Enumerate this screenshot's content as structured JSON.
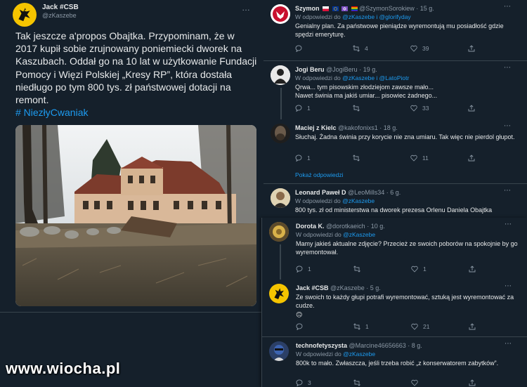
{
  "main_tweet": {
    "author_name": "Jack #CSB",
    "author_handle": "@zKaszebe",
    "text": "Tak jeszcze a'propos Obajtka. Przypominam, że w 2017 kupił sobie zrujnowany poniemiecki dworek na Kaszubach. Oddał go na 10 lat w użytkowanie Fundacji Pomocy i Więzi Polskiej „Kresy RP”, która dostała niedługo po tym 800 tys. zł państwowej dotacji na remont.",
    "hashtag": "# NiezłyCwaniak",
    "more_icon": "…"
  },
  "watermark": "www.wiocha.pl",
  "replies": [
    {
      "name": "Szymon",
      "handle": "@SzymonSorokiew",
      "time": "· 15 g.",
      "reply_prefix": "W odpowiedzi do",
      "reply_to": "@zKaszebe i @glorifyday",
      "text": "Genialny plan. Za państwowe pieniądze wyremontują mu posiadłość gdzie spędzi  emeryturę.",
      "comments": "",
      "retweets": "4",
      "likes": "39"
    },
    {
      "name": "Jogi Beru",
      "handle": "@JogiBeru",
      "time": "· 19 g.",
      "reply_prefix": "W odpowiedzi do",
      "reply_to": "@zKaszebe i @LatoPiotr",
      "text": "Qrwa... tym pisowskim złodziejom zawsze mało...\nNawet świnia ma jakiś umiar... pisowiec żadnego...",
      "comments": "1",
      "retweets": "",
      "likes": "33"
    },
    {
      "name": "Maciej z Kielc",
      "handle": "@kakofonixs1",
      "time": "· 18 g.",
      "text": "Słuchaj. Żadna świnia przy korycie nie zna umiaru. Tak więc nie pierdol głupot.",
      "comments": "1",
      "retweets": "",
      "likes": "11",
      "show_more": "Pokaż odpowiedzi"
    },
    {
      "name": "Leonard Paweł D",
      "handle": "@LeoMills34",
      "time": "· 6 g.",
      "reply_prefix": "W odpowiedzi do",
      "reply_to": "@zKaszebe",
      "text": "800 tys. zł od ministerstwa na dworek prezesa Orlenu Daniela Obajtka"
    },
    {
      "name": "Dorota K.",
      "handle": "@dorotkaeich",
      "time": "· 10 g.",
      "reply_prefix": "W odpowiedzi do",
      "reply_to": "@zKaszebe",
      "text": "Mamy jakieś aktualne zdjęcie? Przecież ze swoich poborów na spokojnie by go wyremontował.",
      "comments": "1",
      "retweets": "",
      "likes": "1"
    },
    {
      "name": "Jack #CSB",
      "handle": "@zKaszebe",
      "time": "· 5 g.",
      "text": "Ze swoich to każdy głupi potrafi wyremontować, sztuką jest wyremontować za cudze.",
      "emoji": "🙃",
      "comments": "",
      "retweets": "1",
      "likes": "21"
    },
    {
      "name": "technofetyszysta",
      "handle": "@Marcine46656663",
      "time": "· 8 g.",
      "reply_prefix": "W odpowiedzi do",
      "reply_to": "@zKaszebe",
      "text": "800k to mało. Zwłaszcza, jeśli trzeba robić „z konserwatorem zabytków”.",
      "comments": "3",
      "retweets": "",
      "likes": ""
    }
  ],
  "colors": {
    "background": "#15202b",
    "text": "#e7e9ea",
    "muted": "#8b98a5",
    "link": "#1d9bf0",
    "separator": "#38444d"
  },
  "icons": {
    "more": "more-icon",
    "comment": "comment-icon",
    "retweet": "retweet-icon",
    "like": "heart-icon",
    "share": "share-icon"
  }
}
